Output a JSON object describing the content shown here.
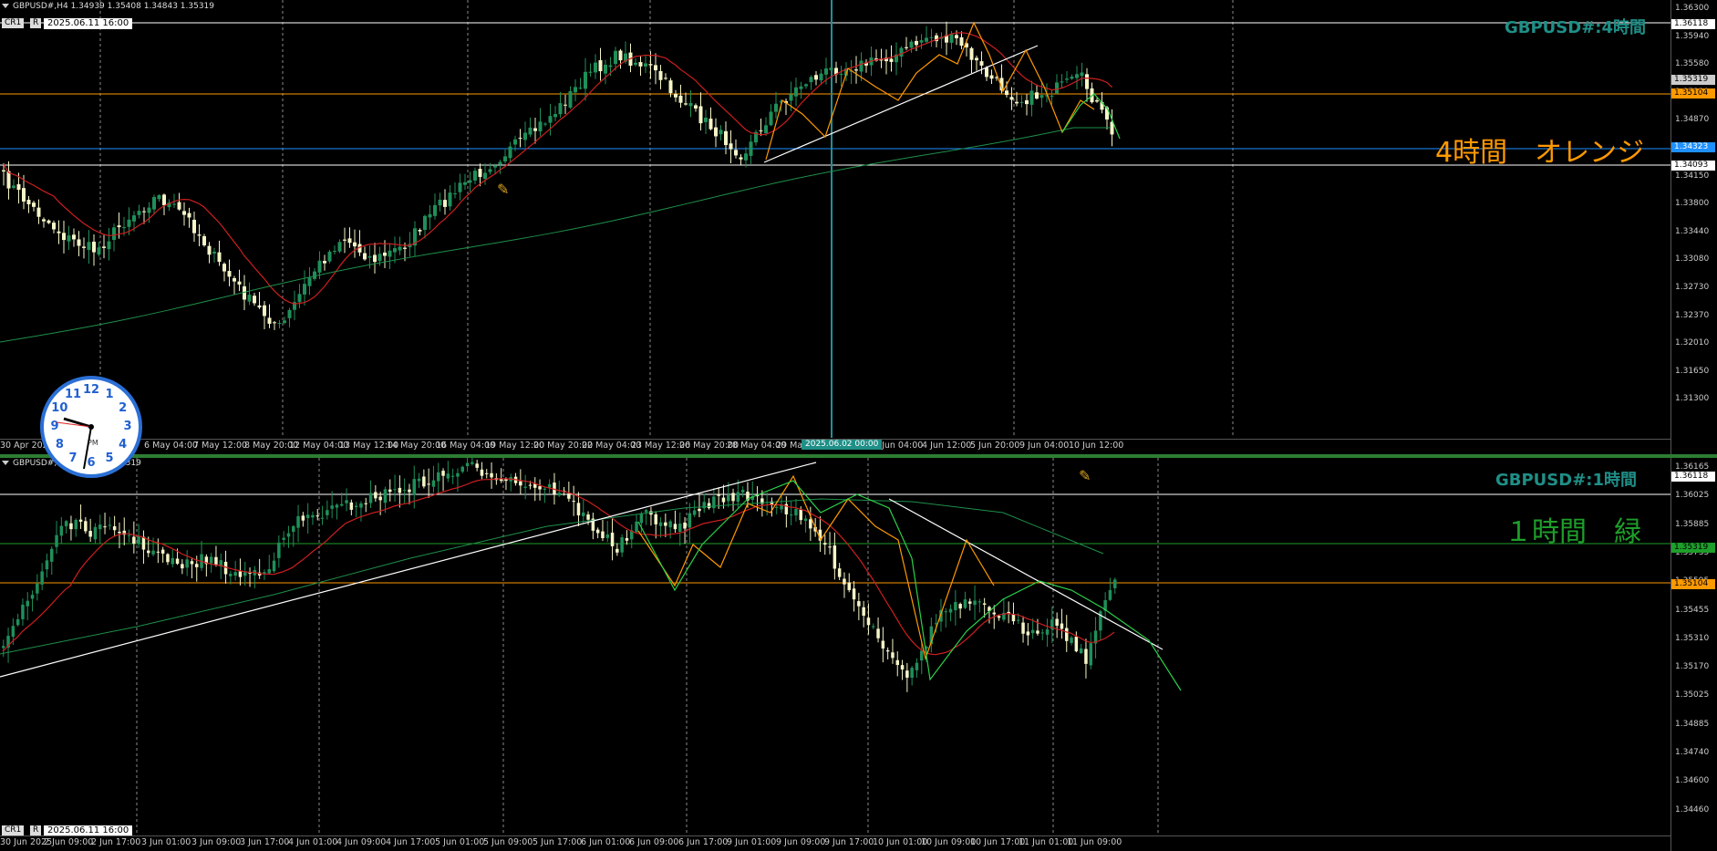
{
  "top": {
    "header": "GBPUSD#,H4  1.34939 1.35408 1.34843 1.35319",
    "badge_cr": "CR1",
    "badge_r": "R",
    "datetime": "2025.06.11 16:00",
    "symbol_label": "GBPUSD#:4時間",
    "tag": "4時間　オレンジ",
    "tag_color": "#ff9900",
    "symbol_color": "#1f8f87",
    "price_labels": [
      "1.36300",
      "1.35940",
      "1.35580",
      "1.35220",
      "1.34870",
      "1.34510",
      "1.34150",
      "1.33800",
      "1.33440",
      "1.33080",
      "1.32730",
      "1.32370",
      "1.32010",
      "1.31650",
      "1.31300"
    ],
    "boxes": [
      {
        "text": "1.36118",
        "bg": "#ffffff",
        "fg": "#000000"
      },
      {
        "text": "1.35319",
        "bg": "#cccccc",
        "fg": "#000000"
      },
      {
        "text": "1.35104",
        "bg": "#ff9900",
        "fg": "#000000"
      },
      {
        "text": "1.34323",
        "bg": "#1e90ff",
        "fg": "#ffffff"
      },
      {
        "text": "1.34093",
        "bg": "#ffffff",
        "fg": "#000000"
      }
    ],
    "time_labels": [
      "30 Apr 2025",
      "6 May 04:00",
      "7 May 12:00",
      "8 May 20:00",
      "12 May 04:00",
      "13 May 12:00",
      "14 May 20:00",
      "16 May 04:00",
      "19 May 12:00",
      "20 May 20:00",
      "22 May 04:00",
      "23 May 12:00",
      "26 May 20:00",
      "28 May 04:00",
      "29 May 12:00",
      "3 Jun 04:00",
      "4 Jun 12:00",
      "5 Jun 20:00",
      "9 Jun 04:00",
      "10 Jun 12:00"
    ],
    "cursor_label": "2025.06.02 00:00"
  },
  "bottom": {
    "header": "GBPUSD#,H1  1.34878 1.35319",
    "badge_cr": "CR1",
    "badge_r": "R",
    "datetime": "2025.06.11 16:00",
    "symbol_label": "GBPUSD#:1時間",
    "tag": "１時間　緑",
    "tag_color": "#1e9e2a",
    "price_labels": [
      "1.36165",
      "1.36025",
      "1.35885",
      "1.35735",
      "1.35595",
      "1.35455",
      "1.35310",
      "1.35170",
      "1.35025",
      "1.34885",
      "1.34740",
      "1.34600",
      "1.34460"
    ],
    "boxes": [
      {
        "text": "1.36118",
        "bg": "#ffffff",
        "fg": "#000000"
      },
      {
        "text": "1.35319",
        "bg": "#1e9e2a",
        "fg": "#000000"
      },
      {
        "text": "1.35104",
        "bg": "#ff9900",
        "fg": "#000000"
      }
    ],
    "time_labels": [
      "30 Jun 2025",
      "2 Jun 09:00",
      "2 Jun 17:00",
      "3 Jun 01:00",
      "3 Jun 09:00",
      "3 Jun 17:00",
      "4 Jun 01:00",
      "4 Jun 09:00",
      "4 Jun 17:00",
      "5 Jun 01:00",
      "5 Jun 09:00",
      "5 Jun 17:00",
      "6 Jun 01:00",
      "6 Jun 09:00",
      "6 Jun 17:00",
      "9 Jun 01:00",
      "9 Jun 09:00",
      "9 Jun 17:00",
      "10 Jun 01:00",
      "10 Jun 09:00",
      "10 Jun 17:00",
      "11 Jun 01:00",
      "11 Jun 09:00"
    ]
  },
  "clock": {
    "numbers": [
      "12",
      "1",
      "2",
      "3",
      "4",
      "5",
      "6",
      "7",
      "8",
      "9",
      "10",
      "11"
    ],
    "ampm": "PM"
  },
  "icons": {
    "top_tool": "crossed-pencil-icon",
    "bottom_tool": "crossed-pencil-icon"
  }
}
